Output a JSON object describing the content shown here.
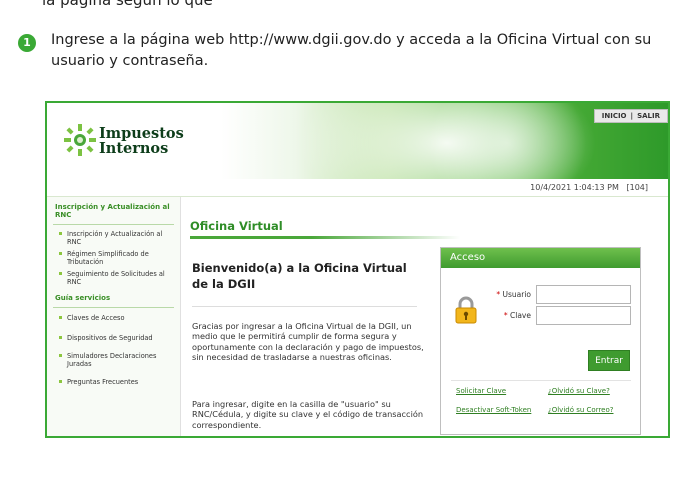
{
  "instruction": {
    "top_cut_text": "la página según lo que",
    "step_number": "1",
    "text": "Ingrese a la página web http://www.dgii.gov.do y acceda a la Oficina Virtual con su usuario y contraseña."
  },
  "header": {
    "logo_line1": "Impuestos",
    "logo_line2": "Internos",
    "nav_inicio": "INICIO",
    "nav_sep": "|",
    "nav_salir": "SALIR",
    "datetime": "10/4/2021 1:04:13 PM",
    "code": "[104]"
  },
  "sidebar": {
    "section1_title": "Inscripción y Actualización al RNC",
    "section1_items": [
      "Inscripción y Actualización al RNC",
      "Régimen Simplificado de Tributación",
      "Seguimiento de Solicitudes al RNC"
    ],
    "section2_title": "Guía servicios",
    "section2_items": [
      "Claves de Acceso",
      "Dispositivos de Seguridad",
      "Simuladores Declaraciones Juradas",
      "Preguntas Frecuentes"
    ]
  },
  "main": {
    "title": "Oficina Virtual",
    "welcome": "Bienvenido(a) a la Oficina Virtual de la DGII",
    "paragraph1": "Gracias por ingresar a la Oficina Virtual de la DGII, un medio que le permitirá cumplir de forma segura y oportunamente con la declaración y pago de impuestos, sin necesidad de trasladarse a nuestras oficinas.",
    "paragraph2": "Para ingresar, digite en la casilla de \"usuario\" su RNC/Cédula, y digite su clave y el código de transacción correspondiente."
  },
  "access": {
    "title": "Acceso",
    "required_mark": "*",
    "usuario_label": "Usuario",
    "clave_label": "Clave",
    "usuario_value": "",
    "clave_value": "",
    "entrar_label": "Entrar",
    "link_solicitar": "Solicitar Clave",
    "link_olvido_clave": "¿Olvidó su Clave?",
    "link_desactivar": "Desactivar Soft-Token",
    "link_olvido_correo": "¿Olvidó su Correo?"
  },
  "colors": {
    "brand_green": "#3aa935",
    "link_green": "#2f7f22"
  }
}
